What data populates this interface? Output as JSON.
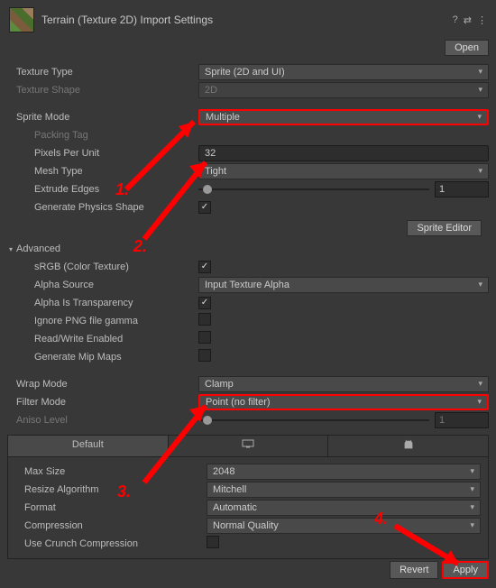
{
  "header": {
    "title": "Terrain (Texture 2D) Import Settings",
    "open": "Open"
  },
  "textureType": {
    "label": "Texture Type",
    "value": "Sprite (2D and UI)"
  },
  "textureShape": {
    "label": "Texture Shape",
    "value": "2D"
  },
  "spriteMode": {
    "label": "Sprite Mode",
    "value": "Multiple"
  },
  "packingTag": {
    "label": "Packing Tag"
  },
  "pixelsPerUnit": {
    "label": "Pixels Per Unit",
    "value": "32"
  },
  "meshType": {
    "label": "Mesh Type",
    "value": "Tight"
  },
  "extrudeEdges": {
    "label": "Extrude Edges",
    "value": "1"
  },
  "genPhysics": {
    "label": "Generate Physics Shape"
  },
  "spriteEditor": "Sprite Editor",
  "advanced": "Advanced",
  "srgb": {
    "label": "sRGB (Color Texture)"
  },
  "alphaSource": {
    "label": "Alpha Source",
    "value": "Input Texture Alpha"
  },
  "alphaTrans": {
    "label": "Alpha Is Transparency"
  },
  "ignorePng": {
    "label": "Ignore PNG file gamma"
  },
  "readWrite": {
    "label": "Read/Write Enabled"
  },
  "genMip": {
    "label": "Generate Mip Maps"
  },
  "wrapMode": {
    "label": "Wrap Mode",
    "value": "Clamp"
  },
  "filterMode": {
    "label": "Filter Mode",
    "value": "Point (no filter)"
  },
  "anisoLevel": {
    "label": "Aniso Level",
    "value": "1"
  },
  "tabs": {
    "default": "Default"
  },
  "maxSize": {
    "label": "Max Size",
    "value": "2048"
  },
  "resizeAlg": {
    "label": "Resize Algorithm",
    "value": "Mitchell"
  },
  "format": {
    "label": "Format",
    "value": "Automatic"
  },
  "compression": {
    "label": "Compression",
    "value": "Normal Quality"
  },
  "crunch": {
    "label": "Use Crunch Compression"
  },
  "revert": "Revert",
  "apply": "Apply",
  "anno": {
    "a1": "1.",
    "a2": "2.",
    "a3": "3.",
    "a4": "4."
  }
}
